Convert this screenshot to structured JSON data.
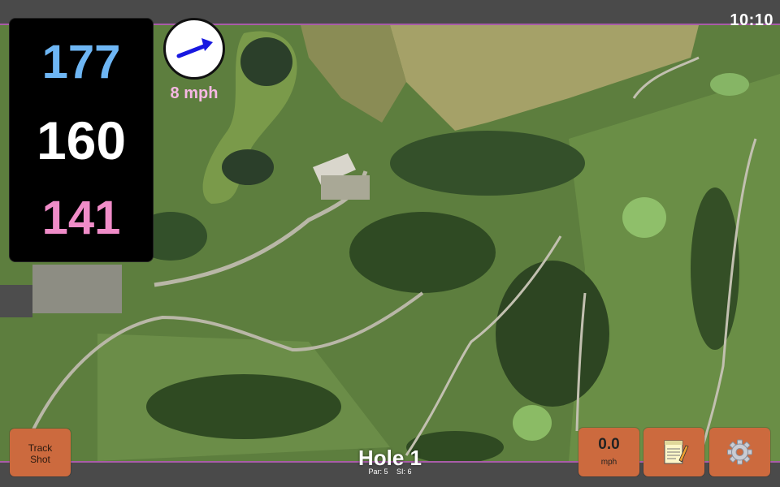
{
  "status": {
    "time": "10:10"
  },
  "distances": {
    "back": "177",
    "middle": "160",
    "front": "141",
    "back_color": "#6eb6f4",
    "middle_color": "#ffffff",
    "front_color": "#f08cc8"
  },
  "wind": {
    "speed": "8 mph",
    "direction_icon": "arrow-right-up-icon",
    "arrow_color": "#1818e0",
    "text_color": "#f6b8e4"
  },
  "buttons": {
    "track_shot_line1": "Track",
    "track_shot_line2": "Shot",
    "speed_value": "0.0",
    "speed_unit": "mph",
    "notes_icon": "notepad-icon",
    "settings_icon": "gear-icon",
    "button_color": "#cc6a3e"
  },
  "hole": {
    "title": "Hole 1",
    "par": "Par: 5",
    "stroke_index": "SI: 6"
  },
  "map": {
    "type": "satellite",
    "border_color": "#a85ca8"
  }
}
